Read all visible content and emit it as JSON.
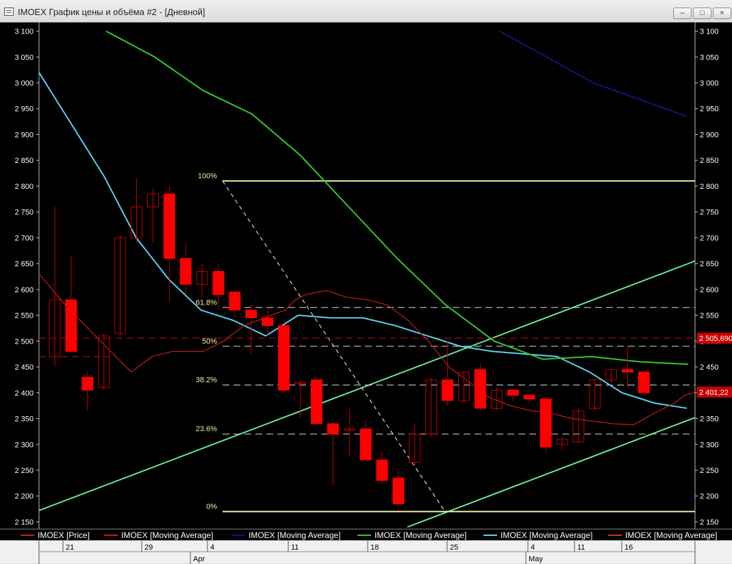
{
  "window": {
    "title": "IMOEX График цены и объёма #2 - [Дневной]",
    "buttons": {
      "minimize": "–",
      "maximize": "□",
      "close": "×"
    },
    "icon": "chart-window-icon"
  },
  "colors": {
    "background": "#000000",
    "bull_candle": "#e00000",
    "bear_candle": "#ff0000",
    "ma_red": "#c81e1e",
    "ma_blue": "#141478",
    "ma_green": "#32c832",
    "ma_cyan": "#5ad2f0",
    "fib_line": "#f0f0a0",
    "channel": "#64e696",
    "axis_text": "#ffffff"
  },
  "chart_data": {
    "type": "candlestick",
    "ylim": [
      2140,
      3110
    ],
    "y_ticks": [
      "2 150",
      "2 200",
      "2 250",
      "2 300",
      "2 350",
      "2 400",
      "2 450",
      "2 500",
      "2 550",
      "2 600",
      "2 650",
      "2 700",
      "2 750",
      "2 800",
      "2 850",
      "2 900",
      "2 950",
      "3 000",
      "3 050",
      "3 100"
    ],
    "y_tick_values": [
      2150,
      2200,
      2250,
      2300,
      2350,
      2400,
      2450,
      2500,
      2550,
      2600,
      2650,
      2700,
      2750,
      2800,
      2850,
      2900,
      2950,
      3000,
      3050,
      3100
    ],
    "x_tick_labels": [
      "21",
      "29",
      "4",
      "11",
      "18",
      "25",
      "4",
      "11",
      "16"
    ],
    "x_tick_index": [
      2,
      6,
      10,
      15,
      20,
      25,
      30,
      35,
      39
    ],
    "month_labels": [
      "Apr",
      "May"
    ],
    "month_index": [
      9,
      29
    ],
    "candles": [
      {
        "o": 2470,
        "h": 2760,
        "l": 2450,
        "c": 2580
      },
      {
        "o": 2580,
        "h": 2665,
        "l": 2480,
        "c": 2480
      },
      {
        "o": 2430,
        "h": 2440,
        "l": 2365,
        "c": 2405
      },
      {
        "o": 2410,
        "h": 2515,
        "l": 2405,
        "c": 2510
      },
      {
        "o": 2515,
        "h": 2705,
        "l": 2510,
        "c": 2700
      },
      {
        "o": 2700,
        "h": 2815,
        "l": 2690,
        "c": 2760
      },
      {
        "o": 2760,
        "h": 2795,
        "l": 2690,
        "c": 2785
      },
      {
        "o": 2785,
        "h": 2800,
        "l": 2575,
        "c": 2660
      },
      {
        "o": 2660,
        "h": 2690,
        "l": 2590,
        "c": 2610
      },
      {
        "o": 2610,
        "h": 2650,
        "l": 2585,
        "c": 2635
      },
      {
        "o": 2635,
        "h": 2650,
        "l": 2560,
        "c": 2590
      },
      {
        "o": 2595,
        "h": 2600,
        "l": 2545,
        "c": 2560
      },
      {
        "o": 2560,
        "h": 2570,
        "l": 2475,
        "c": 2545
      },
      {
        "o": 2545,
        "h": 2560,
        "l": 2510,
        "c": 2530
      },
      {
        "o": 2530,
        "h": 2530,
        "l": 2400,
        "c": 2405
      },
      {
        "o": 2420,
        "h": 2425,
        "l": 2350,
        "c": 2420
      },
      {
        "o": 2425,
        "h": 2430,
        "l": 2340,
        "c": 2340
      },
      {
        "o": 2340,
        "h": 2345,
        "l": 2220,
        "c": 2320
      },
      {
        "o": 2330,
        "h": 2370,
        "l": 2275,
        "c": 2330
      },
      {
        "o": 2330,
        "h": 2345,
        "l": 2270,
        "c": 2270
      },
      {
        "o": 2270,
        "h": 2285,
        "l": 2225,
        "c": 2230
      },
      {
        "o": 2235,
        "h": 2250,
        "l": 2175,
        "c": 2185
      },
      {
        "o": 2265,
        "h": 2340,
        "l": 2260,
        "c": 2320
      },
      {
        "o": 2320,
        "h": 2430,
        "l": 2315,
        "c": 2425
      },
      {
        "o": 2425,
        "h": 2500,
        "l": 2375,
        "c": 2385
      },
      {
        "o": 2385,
        "h": 2440,
        "l": 2380,
        "c": 2440
      },
      {
        "o": 2445,
        "h": 2455,
        "l": 2365,
        "c": 2370
      },
      {
        "o": 2370,
        "h": 2410,
        "l": 2365,
        "c": 2405
      },
      {
        "o": 2405,
        "h": 2410,
        "l": 2385,
        "c": 2395
      },
      {
        "o": 2395,
        "h": 2398,
        "l": 2380,
        "c": 2388
      },
      {
        "o": 2388,
        "h": 2392,
        "l": 2285,
        "c": 2295
      },
      {
        "o": 2300,
        "h": 2315,
        "l": 2290,
        "c": 2310
      },
      {
        "o": 2305,
        "h": 2370,
        "l": 2300,
        "c": 2365
      },
      {
        "o": 2370,
        "h": 2430,
        "l": 2365,
        "c": 2425
      },
      {
        "o": 2425,
        "h": 2445,
        "l": 2420,
        "c": 2445
      },
      {
        "o": 2445,
        "h": 2490,
        "l": 2410,
        "c": 2440
      },
      {
        "o": 2440,
        "h": 2445,
        "l": 2395,
        "c": 2400
      }
    ],
    "ma_red": [
      2630,
      2560,
      2480,
      2440,
      2470,
      2480,
      2480,
      2500,
      2530,
      2545,
      2560,
      2580,
      2590,
      2598,
      2585,
      2580,
      2570,
      2540,
      2500,
      2450,
      2420,
      2390,
      2375,
      2365,
      2360,
      2350,
      2345,
      2340,
      2338,
      2360,
      2380,
      2395,
      2401
    ],
    "ma_red_index": [
      0,
      3,
      7,
      9,
      11,
      13,
      16,
      18,
      20,
      22,
      24,
      25,
      26,
      28,
      30,
      32,
      34,
      36,
      38,
      40,
      42,
      44,
      46,
      48,
      50,
      52,
      54,
      56,
      58,
      60,
      62,
      63,
      64
    ],
    "ma_cyan": [
      3020,
      2920,
      2820,
      2700,
      2620,
      2560,
      2540,
      2510,
      2550,
      2545,
      2545,
      2530,
      2510,
      2490,
      2480,
      2475,
      2470,
      2440,
      2400,
      2380,
      2370
    ],
    "ma_green": [
      3100,
      3050,
      2985,
      2940,
      2860,
      2760,
      2660,
      2570,
      2500,
      2465,
      2470,
      2460,
      2455
    ],
    "ma_blue": [
      3100,
      3000,
      2935
    ],
    "ma_red_dashed_level": 2505.69,
    "fib_levels": [
      {
        "label": "100%",
        "value": 2810
      },
      {
        "label": "61.8%",
        "value": 2565
      },
      {
        "label": "50%",
        "value": 2490
      },
      {
        "label": "38.2%",
        "value": 2415
      },
      {
        "label": "23.6%",
        "value": 2320
      },
      {
        "label": "0%",
        "value": 2170
      }
    ],
    "price_labels": [
      {
        "text": "2 505,690",
        "value": 2505.69
      },
      {
        "text": "2 401,22",
        "value": 2401.22
      }
    ],
    "legend": [
      {
        "name": "IMOEX [Price]",
        "color": "#c81e1e"
      },
      {
        "name": "IMOEX [Moving Average]",
        "color": "#e01010"
      },
      {
        "name": "IMOEX [Moving Average]",
        "color": "#141478"
      },
      {
        "name": "IMOEX [Moving Average]",
        "color": "#32c832"
      },
      {
        "name": "IMOEX [Moving Average]",
        "color": "#5ad2f0"
      },
      {
        "name": "IMOEX [Moving Average]",
        "color": "#c83232"
      }
    ]
  }
}
